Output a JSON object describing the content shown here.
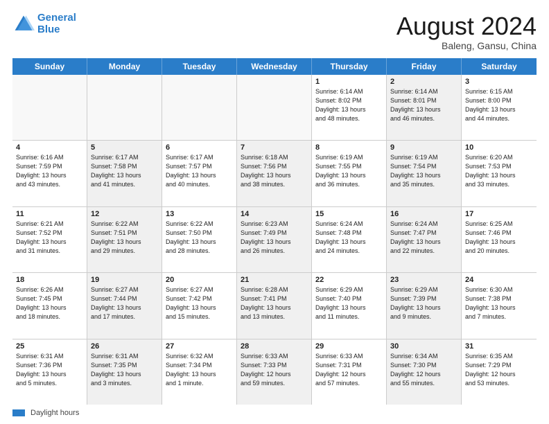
{
  "header": {
    "logo_line1": "General",
    "logo_line2": "Blue",
    "month_title": "August 2024",
    "location": "Baleng, Gansu, China"
  },
  "days_of_week": [
    "Sunday",
    "Monday",
    "Tuesday",
    "Wednesday",
    "Thursday",
    "Friday",
    "Saturday"
  ],
  "weeks": [
    [
      {
        "day": "",
        "info": "",
        "shaded": true
      },
      {
        "day": "",
        "info": "",
        "shaded": true
      },
      {
        "day": "",
        "info": "",
        "shaded": true
      },
      {
        "day": "",
        "info": "",
        "shaded": true
      },
      {
        "day": "1",
        "info": "Sunrise: 6:14 AM\nSunset: 8:02 PM\nDaylight: 13 hours\nand 48 minutes.",
        "shaded": false
      },
      {
        "day": "2",
        "info": "Sunrise: 6:14 AM\nSunset: 8:01 PM\nDaylight: 13 hours\nand 46 minutes.",
        "shaded": true
      },
      {
        "day": "3",
        "info": "Sunrise: 6:15 AM\nSunset: 8:00 PM\nDaylight: 13 hours\nand 44 minutes.",
        "shaded": false
      }
    ],
    [
      {
        "day": "4",
        "info": "Sunrise: 6:16 AM\nSunset: 7:59 PM\nDaylight: 13 hours\nand 43 minutes.",
        "shaded": false
      },
      {
        "day": "5",
        "info": "Sunrise: 6:17 AM\nSunset: 7:58 PM\nDaylight: 13 hours\nand 41 minutes.",
        "shaded": true
      },
      {
        "day": "6",
        "info": "Sunrise: 6:17 AM\nSunset: 7:57 PM\nDaylight: 13 hours\nand 40 minutes.",
        "shaded": false
      },
      {
        "day": "7",
        "info": "Sunrise: 6:18 AM\nSunset: 7:56 PM\nDaylight: 13 hours\nand 38 minutes.",
        "shaded": true
      },
      {
        "day": "8",
        "info": "Sunrise: 6:19 AM\nSunset: 7:55 PM\nDaylight: 13 hours\nand 36 minutes.",
        "shaded": false
      },
      {
        "day": "9",
        "info": "Sunrise: 6:19 AM\nSunset: 7:54 PM\nDaylight: 13 hours\nand 35 minutes.",
        "shaded": true
      },
      {
        "day": "10",
        "info": "Sunrise: 6:20 AM\nSunset: 7:53 PM\nDaylight: 13 hours\nand 33 minutes.",
        "shaded": false
      }
    ],
    [
      {
        "day": "11",
        "info": "Sunrise: 6:21 AM\nSunset: 7:52 PM\nDaylight: 13 hours\nand 31 minutes.",
        "shaded": false
      },
      {
        "day": "12",
        "info": "Sunrise: 6:22 AM\nSunset: 7:51 PM\nDaylight: 13 hours\nand 29 minutes.",
        "shaded": true
      },
      {
        "day": "13",
        "info": "Sunrise: 6:22 AM\nSunset: 7:50 PM\nDaylight: 13 hours\nand 28 minutes.",
        "shaded": false
      },
      {
        "day": "14",
        "info": "Sunrise: 6:23 AM\nSunset: 7:49 PM\nDaylight: 13 hours\nand 26 minutes.",
        "shaded": true
      },
      {
        "day": "15",
        "info": "Sunrise: 6:24 AM\nSunset: 7:48 PM\nDaylight: 13 hours\nand 24 minutes.",
        "shaded": false
      },
      {
        "day": "16",
        "info": "Sunrise: 6:24 AM\nSunset: 7:47 PM\nDaylight: 13 hours\nand 22 minutes.",
        "shaded": true
      },
      {
        "day": "17",
        "info": "Sunrise: 6:25 AM\nSunset: 7:46 PM\nDaylight: 13 hours\nand 20 minutes.",
        "shaded": false
      }
    ],
    [
      {
        "day": "18",
        "info": "Sunrise: 6:26 AM\nSunset: 7:45 PM\nDaylight: 13 hours\nand 18 minutes.",
        "shaded": false
      },
      {
        "day": "19",
        "info": "Sunrise: 6:27 AM\nSunset: 7:44 PM\nDaylight: 13 hours\nand 17 minutes.",
        "shaded": true
      },
      {
        "day": "20",
        "info": "Sunrise: 6:27 AM\nSunset: 7:42 PM\nDaylight: 13 hours\nand 15 minutes.",
        "shaded": false
      },
      {
        "day": "21",
        "info": "Sunrise: 6:28 AM\nSunset: 7:41 PM\nDaylight: 13 hours\nand 13 minutes.",
        "shaded": true
      },
      {
        "day": "22",
        "info": "Sunrise: 6:29 AM\nSunset: 7:40 PM\nDaylight: 13 hours\nand 11 minutes.",
        "shaded": false
      },
      {
        "day": "23",
        "info": "Sunrise: 6:29 AM\nSunset: 7:39 PM\nDaylight: 13 hours\nand 9 minutes.",
        "shaded": true
      },
      {
        "day": "24",
        "info": "Sunrise: 6:30 AM\nSunset: 7:38 PM\nDaylight: 13 hours\nand 7 minutes.",
        "shaded": false
      }
    ],
    [
      {
        "day": "25",
        "info": "Sunrise: 6:31 AM\nSunset: 7:36 PM\nDaylight: 13 hours\nand 5 minutes.",
        "shaded": false
      },
      {
        "day": "26",
        "info": "Sunrise: 6:31 AM\nSunset: 7:35 PM\nDaylight: 13 hours\nand 3 minutes.",
        "shaded": true
      },
      {
        "day": "27",
        "info": "Sunrise: 6:32 AM\nSunset: 7:34 PM\nDaylight: 13 hours\nand 1 minute.",
        "shaded": false
      },
      {
        "day": "28",
        "info": "Sunrise: 6:33 AM\nSunset: 7:33 PM\nDaylight: 12 hours\nand 59 minutes.",
        "shaded": true
      },
      {
        "day": "29",
        "info": "Sunrise: 6:33 AM\nSunset: 7:31 PM\nDaylight: 12 hours\nand 57 minutes.",
        "shaded": false
      },
      {
        "day": "30",
        "info": "Sunrise: 6:34 AM\nSunset: 7:30 PM\nDaylight: 12 hours\nand 55 minutes.",
        "shaded": true
      },
      {
        "day": "31",
        "info": "Sunrise: 6:35 AM\nSunset: 7:29 PM\nDaylight: 12 hours\nand 53 minutes.",
        "shaded": false
      }
    ]
  ],
  "footer": {
    "legend_label": "Daylight hours"
  }
}
